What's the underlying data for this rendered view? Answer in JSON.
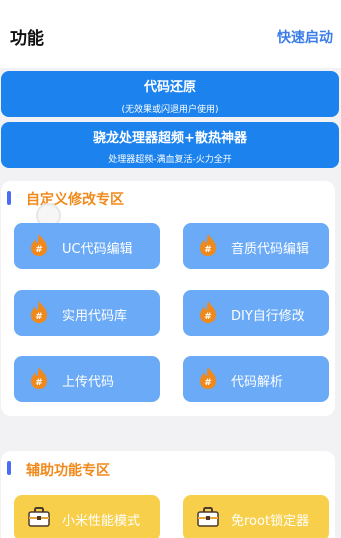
{
  "header": {
    "title": "功能",
    "quick_start": "快速启动"
  },
  "banners": [
    {
      "title": "代码还原",
      "subtitle": "(无效果或闪退用户使用)"
    },
    {
      "title": "骁龙处理器超频+散热神器",
      "subtitle": "处理器超频-满血复活-火力全开"
    }
  ],
  "sections": [
    {
      "title": "自定义修改专区",
      "items": [
        {
          "label": "UC代码编辑",
          "icon": "flame-hash-icon"
        },
        {
          "label": "音质代码编辑",
          "icon": "flame-hash-icon"
        },
        {
          "label": "实用代码库",
          "icon": "flame-hash-icon"
        },
        {
          "label": "DIY自行修改",
          "icon": "flame-hash-icon"
        },
        {
          "label": "上传代码",
          "icon": "flame-hash-icon"
        },
        {
          "label": "代码解析",
          "icon": "flame-hash-icon"
        }
      ]
    },
    {
      "title": "辅助功能专区",
      "items": [
        {
          "label": "小米性能模式",
          "icon": "toolbox-icon"
        },
        {
          "label": "免root锁定器",
          "icon": "toolbox-icon"
        }
      ]
    }
  ],
  "colors": {
    "banner_blue": "#1b82ee",
    "tile_blue": "#6aaaf6",
    "tile_yellow": "#f8cf4a",
    "section_title_orange": "#f08a1c",
    "accent_blue": "#3d7dea"
  }
}
